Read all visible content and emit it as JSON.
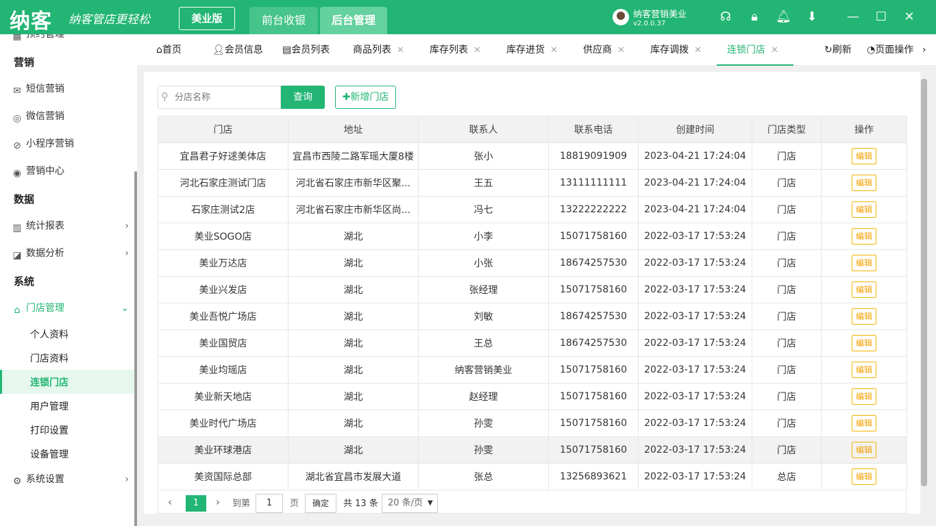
{
  "header": {
    "logo": "纳客",
    "slogan": "纳客管店更轻松",
    "edition": "美业版",
    "tabs": [
      "前台收银",
      "后台管理"
    ],
    "user_name": "纳客营销美业",
    "version": "v2.0.0.37"
  },
  "sidebar": {
    "partial": "预约管理",
    "sections": {
      "marketing": "营销",
      "data": "数据",
      "system": "系统"
    },
    "items": {
      "sms": "短信营销",
      "wechat": "微信营销",
      "miniapp": "小程序营销",
      "center": "营销中心",
      "stats": "统计报表",
      "analysis": "数据分析",
      "store": "门店管理",
      "settings": "系统设置"
    },
    "sub": {
      "profile": "个人资料",
      "store_info": "门店资料",
      "chain": "连锁门店",
      "users": "用户管理",
      "print": "打印设置",
      "devices": "设备管理"
    }
  },
  "tabs": {
    "home": "首页",
    "member_info": "会员信息",
    "member_list": "会员列表",
    "goods": "商品列表",
    "stock": "库存列表",
    "purchase": "库存进货",
    "supplier": "供应商",
    "transfer": "库存调拨",
    "chain": "连锁门店",
    "refresh": "刷新",
    "page_ops": "页面操作"
  },
  "toolbar": {
    "search_placeholder": "分店名称",
    "query": "查询",
    "add": "✚新增门店"
  },
  "table": {
    "headers": [
      "门店",
      "地址",
      "联系人",
      "联系电话",
      "创建时间",
      "门店类型",
      "操作"
    ],
    "rows": [
      [
        "宜昌君子好逑美体店",
        "宜昌市西陵二路军瑶大厦8楼",
        "张小",
        "18819091909",
        "2023-04-21 17:24:04",
        "门店",
        "编辑"
      ],
      [
        "河北石家庄测试门店",
        "河北省石家庄市新华区聚...",
        "王五",
        "13111111111",
        "2023-04-21 17:24:04",
        "门店",
        "编辑"
      ],
      [
        "石家庄测试2店",
        "河北省石家庄市新华区尚...",
        "冯七",
        "13222222222",
        "2023-04-21 17:24:04",
        "门店",
        "编辑"
      ],
      [
        "美业SOGO店",
        "湖北",
        "小李",
        "15071758160",
        "2022-03-17 17:53:24",
        "门店",
        "编辑"
      ],
      [
        "美业万达店",
        "湖北",
        "小张",
        "18674257530",
        "2022-03-17 17:53:24",
        "门店",
        "编辑"
      ],
      [
        "美业兴发店",
        "湖北",
        "张经理",
        "15071758160",
        "2022-03-17 17:53:24",
        "门店",
        "编辑"
      ],
      [
        "美业吾悦广场店",
        "湖北",
        "刘敏",
        "18674257530",
        "2022-03-17 17:53:24",
        "门店",
        "编辑"
      ],
      [
        "美业国贸店",
        "湖北",
        "王总",
        "18674257530",
        "2022-03-17 17:53:24",
        "门店",
        "编辑"
      ],
      [
        "美业均瑶店",
        "湖北",
        "纳客营销美业",
        "15071758160",
        "2022-03-17 17:53:24",
        "门店",
        "编辑"
      ],
      [
        "美业新天地店",
        "湖北",
        "赵经理",
        "15071758160",
        "2022-03-17 17:53:24",
        "门店",
        "编辑"
      ],
      [
        "美业时代广场店",
        "湖北",
        "孙雯",
        "15071758160",
        "2022-03-17 17:53:24",
        "门店",
        "编辑"
      ],
      [
        "美业环球港店",
        "湖北",
        "孙雯",
        "15071758160",
        "2022-03-17 17:53:24",
        "门店",
        "编辑"
      ],
      [
        "美资国际总部",
        "湖北省宜昌市发展大道",
        "张总",
        "13256893621",
        "2022-03-17 17:53:24",
        "总店",
        "编辑"
      ]
    ]
  },
  "pager": {
    "current": "1",
    "goto": "到第",
    "page_value": "1",
    "page_unit": "页",
    "confirm": "确定",
    "total": "共 13 条",
    "per_page": "20 条/页"
  }
}
